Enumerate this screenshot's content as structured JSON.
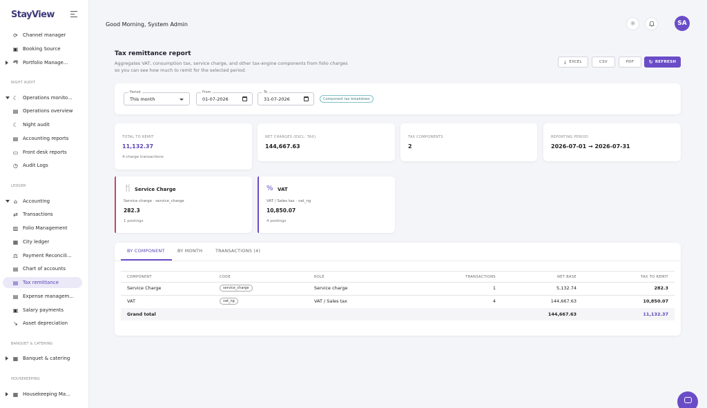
{
  "brand": "StayView",
  "sidebar": {
    "sections": [
      "NIGHT AUDIT",
      "LEDGER",
      "BANQUET & CATERING",
      "HOUSEKEEPING"
    ],
    "items": [
      {
        "label": "Channel manager",
        "icon": "sync-icon"
      },
      {
        "label": "Booking Source",
        "icon": "box-icon"
      },
      {
        "label": "Portfolio Manage...",
        "icon": "group-icon"
      },
      {
        "label": "Operations monito...",
        "icon": "moon-icon"
      },
      {
        "label": "Operations overview",
        "icon": "chart-icon"
      },
      {
        "label": "Night audit",
        "icon": "moon-icon"
      },
      {
        "label": "Accounting reports",
        "icon": "chart-icon"
      },
      {
        "label": "Front desk reports",
        "icon": "bed-icon"
      },
      {
        "label": "Audit Logs",
        "icon": "history-icon"
      },
      {
        "label": "Accounting",
        "icon": "bank-icon"
      },
      {
        "label": "Transactions",
        "icon": "swap-icon"
      },
      {
        "label": "Folio Management",
        "icon": "folio-icon"
      },
      {
        "label": "City ledger",
        "icon": "ledger-icon"
      },
      {
        "label": "Payment Reconcili...",
        "icon": "scale-icon"
      },
      {
        "label": "Chart of accounts",
        "icon": "list-icon"
      },
      {
        "label": "Tax remittance",
        "icon": "receipt-icon"
      },
      {
        "label": "Expense managem...",
        "icon": "expense-icon"
      },
      {
        "label": "Salary payments",
        "icon": "wallet-icon"
      },
      {
        "label": "Asset depreciation",
        "icon": "trend-down-icon"
      },
      {
        "label": "Banquet & catering",
        "icon": "banquet-icon"
      },
      {
        "label": "Housekeeping Ma...",
        "icon": "broom-icon"
      }
    ]
  },
  "header": {
    "greeting": "Good Morning, System Admin",
    "avatar_initials": "SA"
  },
  "report": {
    "title": "Tax remittance report",
    "description": "Aggregates VAT, consumption tax, service charge, and other tax-engine components from folio charges so you can see how much to remit for the selected period.",
    "exports": [
      "EXCEL",
      "CSV",
      "PDF"
    ],
    "refresh_label": "REFRESH"
  },
  "filters": {
    "period_label": "Period",
    "period_value": "This month",
    "from_label": "From",
    "from_value": "01-07-2026",
    "to_label": "To",
    "to_value": "31-07-2026",
    "breakdown_label": "Component tax breakdown"
  },
  "stats": [
    {
      "label": "TOTAL TO REMIT",
      "value": "11,132.37",
      "sub": "4 charge transactions"
    },
    {
      "label": "NET CHARGES (EXCL. TAX)",
      "value": "144,667.63"
    },
    {
      "label": "TAX COMPONENTS",
      "value": "2"
    },
    {
      "label": "REPORTING PERIOD",
      "value": "2026-07-01 → 2026-07-31"
    }
  ],
  "components": [
    {
      "title": "Service Charge",
      "icon_glyph": "🍴",
      "icon": "utensils-icon",
      "meta": "Service charge · service_charge",
      "value": "282.3",
      "postings": "1 postings",
      "color": "#c0486a"
    },
    {
      "title": "VAT",
      "icon_glyph": "%",
      "icon": "percent-icon",
      "meta": "VAT / Sales tax · vat_ng",
      "value": "10,850.07",
      "postings": "4 postings",
      "color": "#6a4cc7"
    }
  ],
  "tabs": [
    "BY COMPONENT",
    "BY MONTH",
    "TRANSACTIONS (4)"
  ],
  "table": {
    "headers": [
      "COMPONENT",
      "CODE",
      "ROLE",
      "TRANSACTIONS",
      "NET BASE",
      "TAX TO REMIT"
    ],
    "rows": [
      {
        "component": "Service Charge",
        "code": "service_charge",
        "role": "Service charge",
        "transactions": "1",
        "net_base": "5,132.74",
        "tax": "282.3"
      },
      {
        "component": "VAT",
        "code": "vat_ng",
        "role": "VAT / Sales tax",
        "transactions": "4",
        "net_base": "144,667.63",
        "tax": "10,850.07"
      }
    ],
    "total": {
      "label": "Grand total",
      "net_base": "144,667.63",
      "tax": "11,132.37"
    }
  }
}
